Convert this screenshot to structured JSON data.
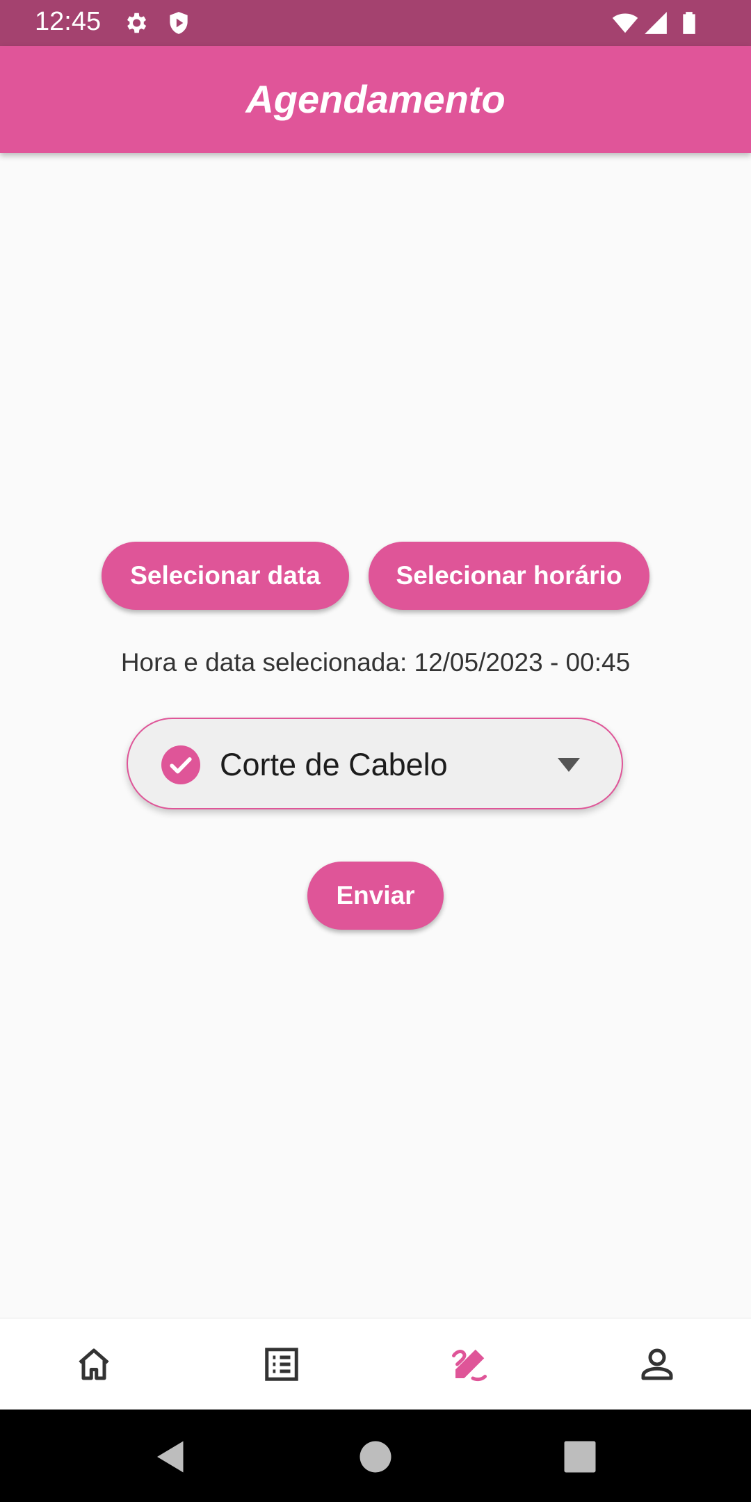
{
  "status_bar": {
    "time": "12:45",
    "icons": [
      "gear-icon",
      "shield-play-icon",
      "wifi-icon",
      "signal-icon",
      "battery-icon"
    ]
  },
  "app_bar": {
    "title": "Agendamento"
  },
  "actions": {
    "select_date": "Selecionar data",
    "select_time": "Selecionar horário"
  },
  "selection_text": "Hora e data selecionada: 12/05/2023 - 00:45",
  "service_dropdown": {
    "selected": "Corte de Cabelo",
    "icon": "check-circle-icon"
  },
  "submit_label": "Enviar",
  "bottom_nav": {
    "items": [
      "home-icon",
      "list-icon",
      "edit-icon",
      "profile-icon"
    ],
    "active": "edit-icon"
  },
  "colors": {
    "primary": "#e05599",
    "status_bar": "#a4426f",
    "background": "#fafafa",
    "text": "#333333"
  }
}
